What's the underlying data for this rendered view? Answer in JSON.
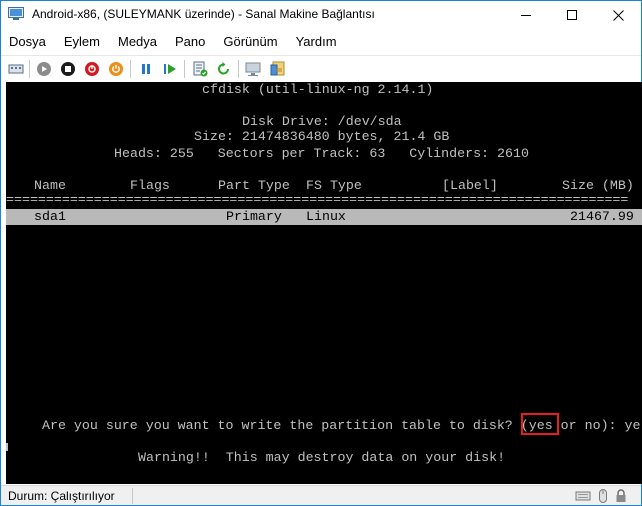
{
  "window": {
    "title": "Android-x86, (SULEYMANK üzerinde) - Sanal Makine Bağlantısı"
  },
  "menubar": {
    "items": [
      "Dosya",
      "Eylem",
      "Medya",
      "Pano",
      "Görünüm",
      "Yardım"
    ]
  },
  "toolbar": {
    "buttons": [
      {
        "name": "ctrl-alt-del-icon"
      },
      {
        "name": "start-icon"
      },
      {
        "name": "stop-icon"
      },
      {
        "name": "shutdown-icon"
      },
      {
        "name": "power-icon"
      },
      {
        "name": "pause-icon"
      },
      {
        "name": "resume-icon"
      },
      {
        "name": "checkpoint-icon"
      },
      {
        "name": "revert-icon"
      },
      {
        "name": "enhanced-session-icon"
      },
      {
        "name": "share-icon"
      }
    ],
    "colors": {
      "grey": "#8c8c8c",
      "black": "#1a1a1a",
      "red": "#d4181f",
      "orange": "#e8901c",
      "blue": "#2777c8",
      "green": "#2aa02a"
    }
  },
  "console": {
    "header": {
      "program": "cfdisk (util-linux-ng 2.14.1)",
      "disk_drive": "Disk Drive: /dev/sda",
      "size": "Size: 21474836480 bytes, 21.4 GB",
      "geometry": "Heads: 255   Sectors per Track: 63   Cylinders: 2610"
    },
    "table": {
      "columns": [
        "Name",
        "Flags",
        "Part Type",
        "FS Type",
        "[Label]",
        "Size (MB)"
      ],
      "rows": [
        {
          "name": "sda1",
          "flags": "",
          "part_type": "Primary",
          "fs_type": "Linux",
          "label": "",
          "size": "21467.99"
        }
      ]
    },
    "prompt_before": "Are you sure you want to write the partition table to disk? ",
    "prompt_answer": "(yes",
    "prompt_after": " or no): ye",
    "warning": "Warning!!  This may destroy data on your disk!",
    "colors": {
      "background": "#000000",
      "text": "#c0c0c0",
      "highlight": "#b9b9b9",
      "annotation": "#e81d1d"
    }
  },
  "statusbar": {
    "status": "Durum: Çalıştırılıyor"
  }
}
